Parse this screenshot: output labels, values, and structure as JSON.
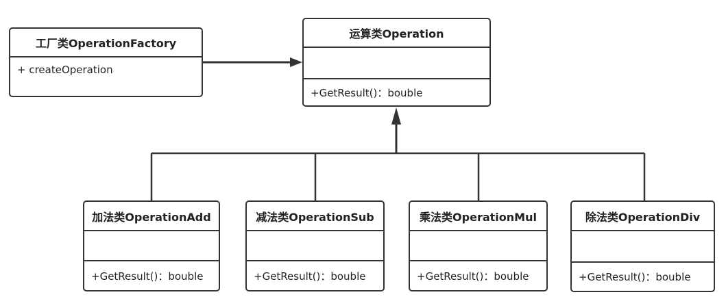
{
  "diagram": {
    "line_color": "#333333",
    "factory": {
      "name": "工厂类OperationFactory",
      "method": "+ createOperation"
    },
    "base": {
      "name": "运算类Operation",
      "method": "+GetResult()：bouble"
    },
    "subclasses": [
      {
        "name": "加法类OperationAdd",
        "method": "+GetResult()：bouble"
      },
      {
        "name": "减法类OperationSub",
        "method": "+GetResult()：bouble"
      },
      {
        "name": "乘法类OperationMul",
        "method": "+GetResult()：bouble"
      },
      {
        "name": "除法类OperationDiv",
        "method": "+GetResult()：bouble"
      }
    ]
  }
}
